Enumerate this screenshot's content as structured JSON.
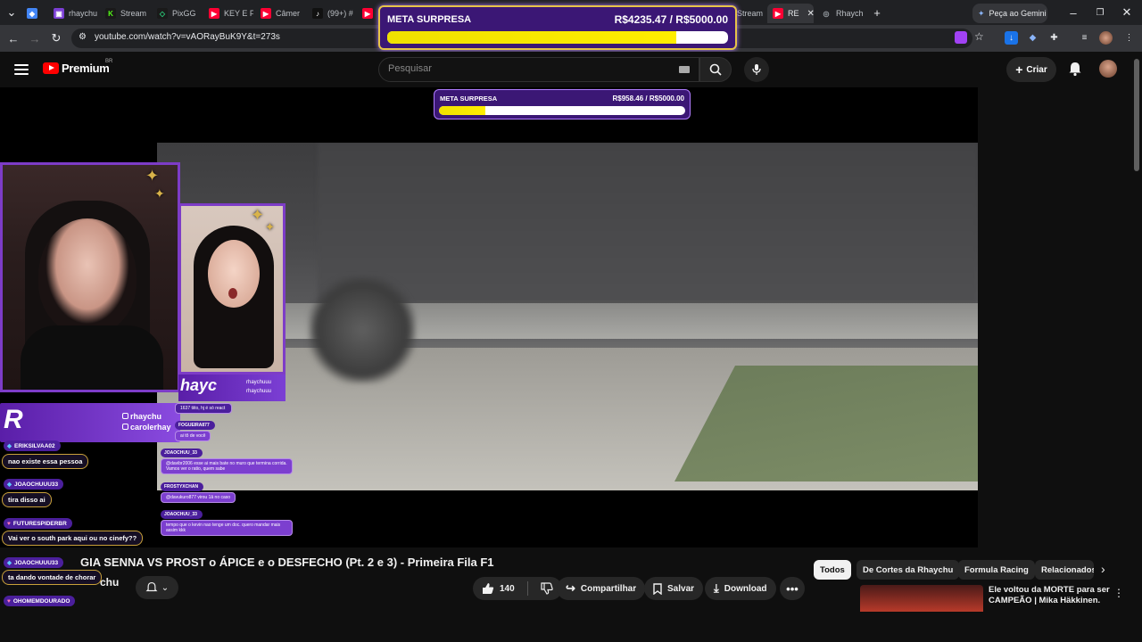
{
  "browser": {
    "tabs": [
      {
        "label": "",
        "color": "#4285f4",
        "glyph": "◆"
      },
      {
        "label": "rhaychu",
        "color": "#7b3fd4",
        "glyph": "▣"
      },
      {
        "label": "Stream",
        "color": "#53fc18",
        "glyph": "K"
      },
      {
        "label": "PixGG",
        "color": "#2bd17e",
        "glyph": "◇"
      },
      {
        "label": "KEY E F",
        "color": "#ff0033",
        "glyph": "▶"
      },
      {
        "label": "Câmer",
        "color": "#ff0033",
        "glyph": "▶"
      },
      {
        "label": "(99+) #",
        "color": "#111111",
        "glyph": "♪"
      },
      {
        "label": "",
        "color": "#ff0033",
        "glyph": "▶"
      },
      {
        "label": "Stream",
        "color": "#53fc18",
        "glyph": "K"
      },
      {
        "label": "RE",
        "color": "#ff0033",
        "glyph": "▶"
      },
      {
        "label": "Rhaych",
        "color": "#9aa0a6",
        "glyph": "◎"
      }
    ],
    "gemini_label": "Peça ao Gemini",
    "url": "youtube.com/watch?v=vAORayBuK9Y&t=273s"
  },
  "goal_top": {
    "label": "META SURPRESA",
    "amount": "R$4235.47 / R$5000.00",
    "progress": 0.847
  },
  "goal_inner": {
    "label": "META SURPRESA",
    "amount": "R$958.46 / R$5000.00",
    "progress": 0.19
  },
  "youtube": {
    "logo": "Premium",
    "country": "BR",
    "search_placeholder": "Pesquisar",
    "create_label": "Criar"
  },
  "overlay": {
    "brand": "R",
    "handle_1": "rhaychu",
    "handle_2": "carolerhay",
    "small_brand": "hayc",
    "small_handle_1": "rhaychuuu",
    "small_handle_2": "rhaychuuu"
  },
  "chat": [
    {
      "name": "ERIKSILVAA02",
      "msg": "nao existe essa pessoa"
    },
    {
      "name": "JOAOCHUUU33",
      "msg": "tira disso ai"
    },
    {
      "name": "FUTURESPIDERBR",
      "msg": "Vai ver o south park aqui ou no cinefy??"
    },
    {
      "name": "JOAOCHUUU33",
      "msg": "ta dando vontade de chorar"
    },
    {
      "name": "OHOMEMDOURADO",
      "msg": ""
    }
  ],
  "chat_secondary": [
    {
      "name": "",
      "msg": "1637 tiito, hj é só react"
    },
    {
      "name": "FOGUEIRA877",
      "msg": "ai tô de você"
    },
    {
      "name": "JOAOCHUU_33",
      "msg": "@davibr2006 esse ai mais bate no muro que termina corrida. Vamos ver o ratio, quem sabe"
    },
    {
      "name": "FROSTYXCHAN",
      "msg": "@davukuro877 virou 1â no caso"
    },
    {
      "name": "JOAOCHUU_33",
      "msg": "tempo que o kevin nao tenge um doc. quero mandar mais assim kkk"
    }
  ],
  "video": {
    "title": "GIA SENNA VS PROST o ÁPICE e o DESFECHO (Pt. 2 e 3) - Primeira Fila F1",
    "channel": "chu",
    "likes": "140",
    "share_label": "Compartilhar",
    "save_label": "Salvar",
    "download_label": "Download"
  },
  "chips": [
    "Todos",
    "De Cortes da Rhaychu",
    "Formula Racing",
    "Relacionados"
  ],
  "recommendation": {
    "title": "Ele voltou da MORTE para ser CAMPEÃO | Mika Häkkinen."
  }
}
